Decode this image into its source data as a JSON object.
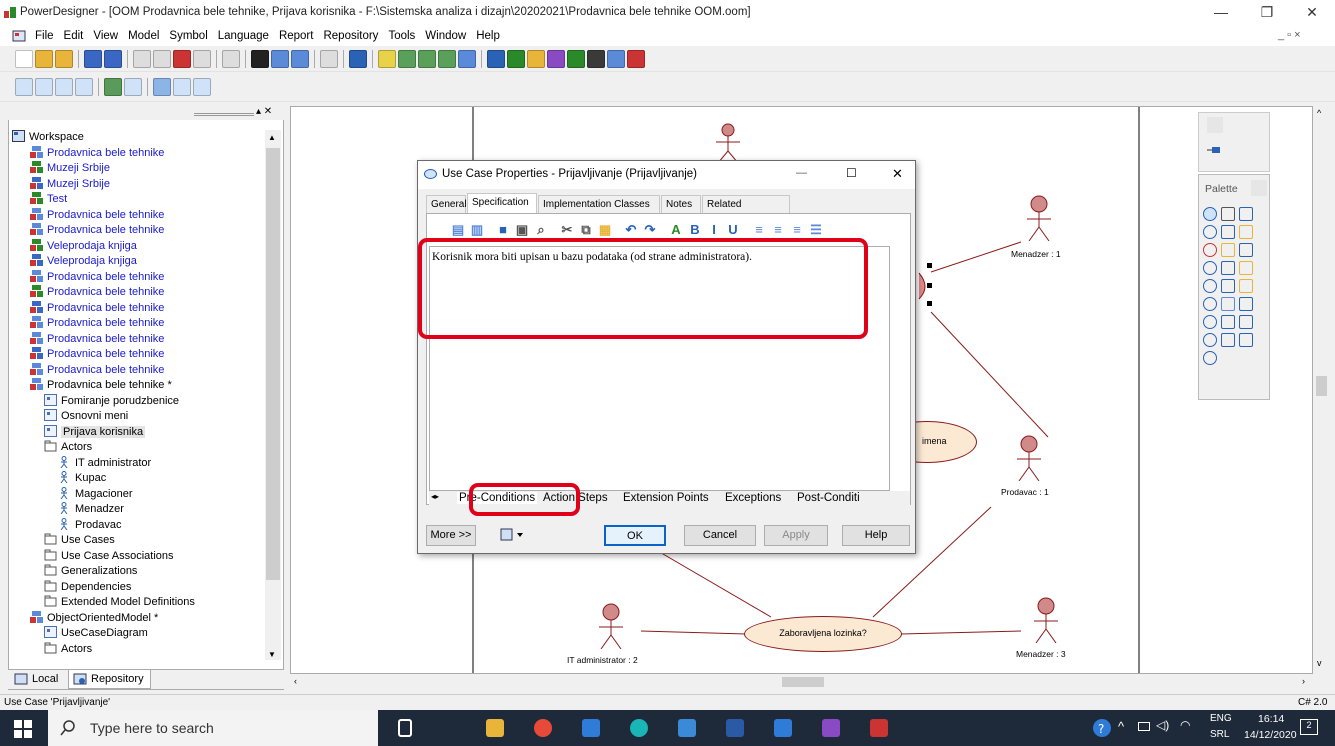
{
  "window": {
    "title": "PowerDesigner - [OOM Prodavnica bele tehnike, Prijava korisnika - F:\\Sistemska analiza i dizajn\\20202021\\Prodavnica bele tehnike OOM.oom]",
    "minimize": "—",
    "restore": "❐",
    "close": "✕"
  },
  "menubar": {
    "items": [
      "File",
      "Edit",
      "View",
      "Model",
      "Symbol",
      "Language",
      "Report",
      "Repository",
      "Tools",
      "Window",
      "Help"
    ],
    "mdi_controls": "_ ▫ ×"
  },
  "workspace": {
    "panel_controls": "▴ ✕",
    "tree": [
      {
        "label": "Workspace",
        "indent": 0,
        "blue": false,
        "icon": "workspace-icon"
      },
      {
        "label": "Prodavnica bele tehnike",
        "indent": 1,
        "blue": true,
        "icon": "oom-model-icon"
      },
      {
        "label": "Muzeji Srbije",
        "indent": 1,
        "blue": true,
        "icon": "ldm-model-icon"
      },
      {
        "label": "Muzeji Srbije",
        "indent": 1,
        "blue": true,
        "icon": "pdm-model-icon"
      },
      {
        "label": "Test",
        "indent": 1,
        "blue": true,
        "icon": "ldm-model-icon"
      },
      {
        "label": "Prodavnica bele tehnike",
        "indent": 1,
        "blue": true,
        "icon": "oom-model-icon"
      },
      {
        "label": "Prodavnica bele tehnike",
        "indent": 1,
        "blue": true,
        "icon": "oom-model-icon"
      },
      {
        "label": "Veleprodaja knjiga",
        "indent": 1,
        "blue": true,
        "icon": "ldm-model-icon"
      },
      {
        "label": "Veleprodaja knjiga",
        "indent": 1,
        "blue": true,
        "icon": "pdm-model-icon"
      },
      {
        "label": "Prodavnica bele tehnike",
        "indent": 1,
        "blue": true,
        "icon": "oom-model-icon"
      },
      {
        "label": "Prodavnica bele tehnike",
        "indent": 1,
        "blue": true,
        "icon": "ldm-model-icon"
      },
      {
        "label": "Prodavnica bele tehnike",
        "indent": 1,
        "blue": true,
        "icon": "pdm-model-icon"
      },
      {
        "label": "Prodavnica bele tehnike",
        "indent": 1,
        "blue": true,
        "icon": "oom-model-icon"
      },
      {
        "label": "Prodavnica bele tehnike",
        "indent": 1,
        "blue": true,
        "icon": "oom-model-icon"
      },
      {
        "label": "Prodavnica bele tehnike",
        "indent": 1,
        "blue": true,
        "icon": "pdm-model-icon"
      },
      {
        "label": "Prodavnica bele tehnike",
        "indent": 1,
        "blue": true,
        "icon": "oom-model-icon"
      },
      {
        "label": "Prodavnica bele tehnike *",
        "indent": 1,
        "blue": false,
        "icon": "oom-model-icon"
      },
      {
        "label": "Fomiranje porudzbenice",
        "indent": 2,
        "blue": false,
        "icon": "diagram-icon"
      },
      {
        "label": "Osnovni meni",
        "indent": 2,
        "blue": false,
        "icon": "diagram-icon"
      },
      {
        "label": "Prijava korisnika",
        "indent": 2,
        "blue": false,
        "icon": "diagram-icon",
        "selected": true
      },
      {
        "label": "Actors",
        "indent": 2,
        "blue": false,
        "icon": "folder-icon"
      },
      {
        "label": "IT administrator",
        "indent": 3,
        "blue": false,
        "icon": "actor-icon"
      },
      {
        "label": "Kupac",
        "indent": 3,
        "blue": false,
        "icon": "actor-icon"
      },
      {
        "label": "Magacioner",
        "indent": 3,
        "blue": false,
        "icon": "actor-icon"
      },
      {
        "label": "Menadzer",
        "indent": 3,
        "blue": false,
        "icon": "actor-icon"
      },
      {
        "label": "Prodavac",
        "indent": 3,
        "blue": false,
        "icon": "actor-icon"
      },
      {
        "label": "Use Cases",
        "indent": 2,
        "blue": false,
        "icon": "folder-icon"
      },
      {
        "label": "Use Case Associations",
        "indent": 2,
        "blue": false,
        "icon": "folder-icon"
      },
      {
        "label": "Generalizations",
        "indent": 2,
        "blue": false,
        "icon": "folder-icon"
      },
      {
        "label": "Dependencies",
        "indent": 2,
        "blue": false,
        "icon": "folder-icon"
      },
      {
        "label": "Extended Model Definitions",
        "indent": 2,
        "blue": false,
        "icon": "folder-icon"
      },
      {
        "label": "ObjectOrientedModel *",
        "indent": 1,
        "blue": false,
        "icon": "oom-model-icon"
      },
      {
        "label": "UseCaseDiagram",
        "indent": 2,
        "blue": false,
        "icon": "diagram-icon"
      },
      {
        "label": "Actors",
        "indent": 2,
        "blue": false,
        "icon": "folder-icon"
      }
    ],
    "tabs": [
      {
        "label": "Local"
      },
      {
        "label": "Repository"
      }
    ]
  },
  "diagram": {
    "actors": [
      {
        "label": "Menadzer : 1"
      },
      {
        "label": "Prodavac : 1"
      },
      {
        "label": "IT administrator : 2"
      },
      {
        "label": "Menadzer : 3"
      }
    ],
    "usecases": [
      {
        "label": "imena"
      },
      {
        "label": "Zaboravljena lozinka?"
      }
    ],
    "colors": {
      "usecase_fill": "#fbe9d4",
      "usecase_stroke": "#8b1a1a",
      "actor": "#8b1a1a",
      "link": "#8b1a1a"
    }
  },
  "palette": {
    "title": "Palette"
  },
  "dialog": {
    "title": "Use Case Properties - Prijavljivanje (Prijavljivanje)",
    "tabs": [
      {
        "label": "General",
        "active": false
      },
      {
        "label": "Specification",
        "active": true
      },
      {
        "label": "Implementation Classes",
        "active": false
      },
      {
        "label": "Notes",
        "active": false
      },
      {
        "label": "Related Diagrams",
        "active": false
      }
    ],
    "text": "Korisnik mora biti upisan u bazu podataka (od strane administratora).",
    "subtabs": [
      "Pre-Conditions",
      "Action Steps",
      "Extension Points",
      "Exceptions",
      "Post-Conditi"
    ],
    "buttons": {
      "more": "More >>",
      "ok": "OK",
      "cancel": "Cancel",
      "apply": "Apply",
      "help": "Help"
    },
    "minimize": "—",
    "maximize": "☐",
    "close": "✕"
  },
  "statusbar": {
    "left": "Use Case 'Prijavljivanje'",
    "right": "C# 2.0"
  },
  "taskbar": {
    "search_placeholder": "Type here to search",
    "lang1": "ENG",
    "lang2": "SRL",
    "time": "16:14",
    "date": "14/12/2020",
    "notifications": "2"
  }
}
